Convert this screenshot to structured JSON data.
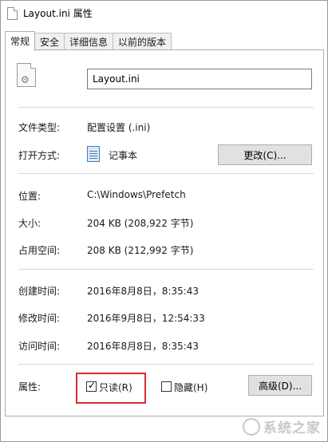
{
  "window": {
    "title": "Layout.ini 属性"
  },
  "tabs": [
    {
      "label": "常规",
      "active": true
    },
    {
      "label": "安全",
      "active": false
    },
    {
      "label": "详细信息",
      "active": false
    },
    {
      "label": "以前的版本",
      "active": false
    }
  ],
  "file": {
    "name": "Layout.ini",
    "icon": "ini-settings-file-icon"
  },
  "general": {
    "type_label": "文件类型:",
    "type_value": "配置设置 (.ini)",
    "opens_label": "打开方式:",
    "opens_value": "记事本",
    "opens_icon": "notepad-icon",
    "change_button": "更改(C)...",
    "location_label": "位置:",
    "location_value": "C:\\Windows\\Prefetch",
    "size_label": "大小:",
    "size_value": "204 KB (208,922 字节)",
    "disk_label": "占用空间:",
    "disk_value": "208 KB (212,992 字节)",
    "created_label": "创建时间:",
    "created_value": "2016年8月8日，8:35:43",
    "modified_label": "修改时间:",
    "modified_value": "2016年9月8日，12:54:33",
    "accessed_label": "访问时间:",
    "accessed_value": "2016年8月8日，8:35:43",
    "attrs_label": "属性:",
    "readonly_label": "只读(R)",
    "readonly_checked": true,
    "hidden_label": "隐藏(H)",
    "hidden_checked": false,
    "advanced_button": "高级(D)..."
  },
  "watermark": {
    "text": "系统之家"
  },
  "colors": {
    "highlight": "#d32f2f",
    "button_bg": "#e1e1e1",
    "notepad": "#4a7fb5"
  }
}
